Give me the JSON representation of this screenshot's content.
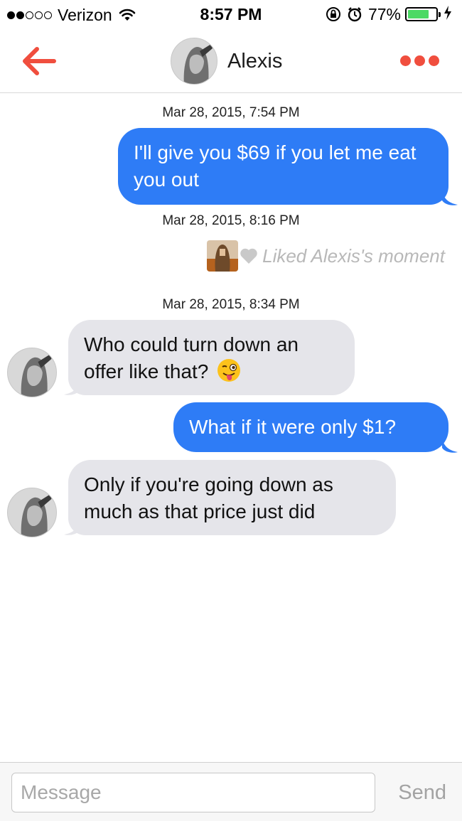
{
  "status_bar": {
    "carrier": "Verizon",
    "time": "8:57 PM",
    "battery_percent": "77%",
    "battery_level": 0.77,
    "signal_bars_filled": 2,
    "signal_bars_total": 5,
    "icons": [
      "wifi-icon",
      "rotation-lock-icon",
      "alarm-icon",
      "battery-icon",
      "charging-bolt-icon"
    ]
  },
  "nav": {
    "back_icon": "back-arrow-icon",
    "contact_name": "Alexis",
    "more_icon": "more-dots-icon",
    "accent_color": "#f04e3e"
  },
  "chat": {
    "timestamps": [
      "Mar 28, 2015, 7:54 PM",
      "Mar 28, 2015, 8:16 PM",
      "Mar 28, 2015, 8:34 PM"
    ],
    "messages": [
      {
        "direction": "out",
        "text": "I'll give you $69 if you let me eat you out"
      },
      {
        "direction": "in",
        "text": "Who could turn down an offer like that?",
        "emoji": "winking-tongue-emoji"
      },
      {
        "direction": "out",
        "text": "What if it were only $1?"
      },
      {
        "direction": "in",
        "text": "Only if you're going down as much as that price just did"
      }
    ],
    "liked_moment": "Liked Alexis's moment",
    "outgoing_color": "#2e7cf6",
    "incoming_color": "#e5e5ea"
  },
  "input_bar": {
    "placeholder": "Message",
    "send_label": "Send"
  }
}
